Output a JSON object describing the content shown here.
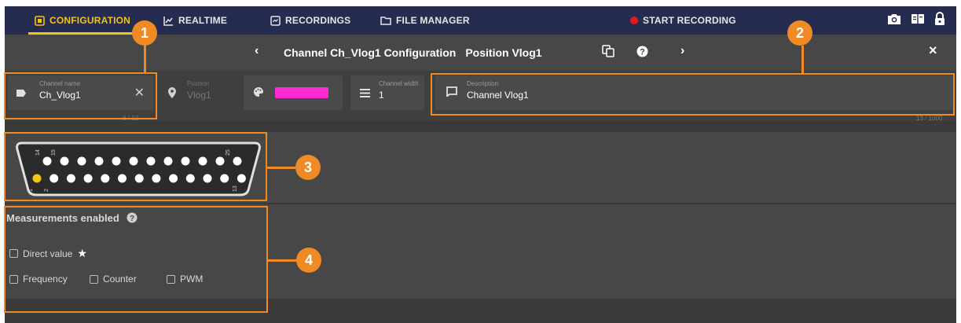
{
  "nav": {
    "tabs": [
      {
        "label": "CONFIGURATION",
        "icon": "config-icon",
        "active": true
      },
      {
        "label": "REALTIME",
        "icon": "realtime-icon",
        "active": false
      },
      {
        "label": "RECORDINGS",
        "icon": "recordings-icon",
        "active": false
      },
      {
        "label": "FILE MANAGER",
        "icon": "folder-icon",
        "active": false
      }
    ],
    "start_recording": "START RECORDING",
    "right_icons": [
      "camera-icon",
      "book-icon",
      "lock-icon"
    ]
  },
  "header": {
    "title": "Channel Ch_Vlog1 Configuration",
    "position": "Position Vlog1",
    "icons": [
      "chevron-left-icon",
      "copy-icon",
      "help-icon",
      "chevron-right-icon",
      "close-icon"
    ]
  },
  "fields": {
    "channel_name": {
      "label": "Channel name",
      "value": "Ch_Vlog1",
      "counter": "8 / 12"
    },
    "position": {
      "label": "Position",
      "value": "Vlog1"
    },
    "color": {
      "value": "#ff2ad4"
    },
    "channel_width": {
      "label": "Channel width",
      "value": "1"
    },
    "description": {
      "label": "Description",
      "value": "Channel Vlog1",
      "counter": "13 / 1000"
    }
  },
  "connector": {
    "pin_labels": {
      "top_left_a": "14",
      "top_left_b": "15",
      "top_right": "25",
      "bottom_left_a": "1",
      "bottom_left_b": "2",
      "bottom_right": "13"
    },
    "top_pin_count": 12,
    "bottom_pin_count": 13,
    "selected_pin": 1,
    "selected_color": "#f0c418"
  },
  "measurements": {
    "title": "Measurements enabled",
    "items": [
      {
        "label": "Direct value",
        "checked": false,
        "starred": true
      },
      {
        "label": "Frequency",
        "checked": false
      },
      {
        "label": "Counter",
        "checked": false
      },
      {
        "label": "PWM",
        "checked": false
      }
    ]
  },
  "callouts": [
    "1",
    "2",
    "3",
    "4"
  ],
  "colors": {
    "accent": "#f08a24",
    "nav_bg": "#262b50",
    "active_tab": "#f0c418",
    "record": "#e01b1b"
  }
}
